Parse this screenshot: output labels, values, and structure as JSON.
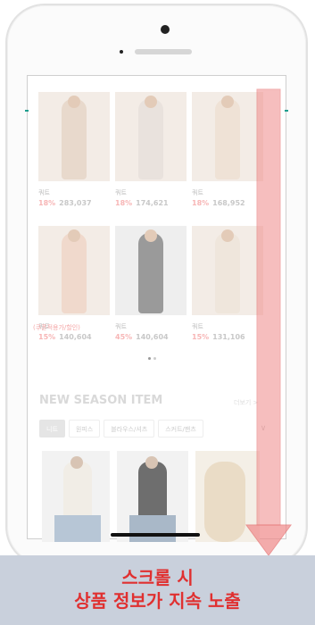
{
  "products_row1": [
    {
      "brand": "쿼트",
      "discount": "18%",
      "price": "283,037"
    },
    {
      "brand": "쿼트",
      "discount": "18%",
      "price": "174,621"
    },
    {
      "brand": "쿼트",
      "discount": "18%",
      "price": "168,952"
    }
  ],
  "products_row2": [
    {
      "brand": "쿼트",
      "discount": "15%",
      "price": "140,604"
    },
    {
      "brand": "쿼트",
      "discount": "45%",
      "price": "140,604"
    },
    {
      "brand": "쿼트",
      "discount": "15%",
      "price": "131,106"
    }
  ],
  "coupon_label": "(쿠폰적용가/할인)",
  "section": {
    "title": "NEW SEASON ITEM",
    "more": "더보기 >"
  },
  "tabs": [
    "니트",
    "원피스",
    "블라우스/셔츠",
    "스커트/팬츠"
  ],
  "tab_arrow": "∨",
  "caption": {
    "line1": "스크롤 시",
    "line2": "상품 정보가 지속 노출"
  },
  "colors": {
    "caption_text": "#e03030",
    "caption_bg": "#c9d0dc",
    "arrow": "#f08a8a",
    "accent": "#1e9e8e"
  }
}
